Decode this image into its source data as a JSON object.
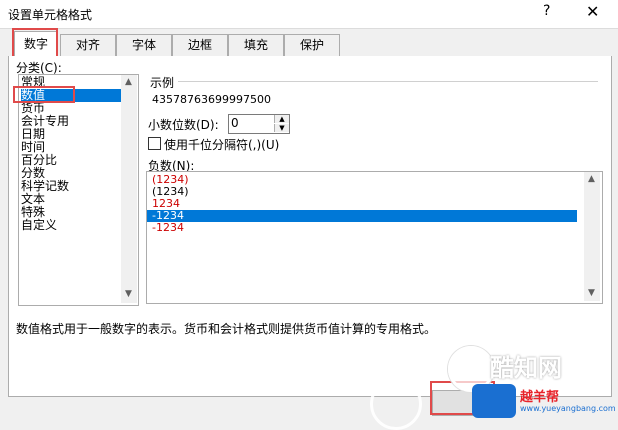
{
  "window": {
    "title": "设置单元格格式",
    "help_glyph": "?",
    "close_glyph": "✕"
  },
  "tabs": [
    {
      "label": "数字",
      "active": true
    },
    {
      "label": "对齐",
      "active": false
    },
    {
      "label": "字体",
      "active": false
    },
    {
      "label": "边框",
      "active": false
    },
    {
      "label": "填充",
      "active": false
    },
    {
      "label": "保护",
      "active": false
    }
  ],
  "category": {
    "label": "分类(C):",
    "items": [
      "常规",
      "数值",
      "货币",
      "会计专用",
      "日期",
      "时间",
      "百分比",
      "分数",
      "科学记数",
      "文本",
      "特殊",
      "自定义"
    ],
    "selected": "数值"
  },
  "sample": {
    "label": "示例",
    "value": "43578763699997500"
  },
  "decimals": {
    "label": "小数位数(D):",
    "value": "0"
  },
  "thousands": {
    "label": "使用千位分隔符(,)(U)",
    "checked": false
  },
  "negative": {
    "label": "负数(N):",
    "items": [
      {
        "text": "(1234)",
        "color": "#cc0000"
      },
      {
        "text": "(1234)",
        "color": "#000000"
      },
      {
        "text": "1234",
        "color": "#cc0000"
      },
      {
        "text": "-1234",
        "color": "#000000",
        "selected": true
      },
      {
        "text": "-1234",
        "color": "#cc0000"
      }
    ]
  },
  "description": "数值格式用于一般数字的表示。货币和会计格式则提供货币值计算的专用格式。",
  "watermark": {
    "brand": "酷知网",
    "site": "越羊帮",
    "url": "www.yueyangbang.com"
  },
  "colors": {
    "accent": "#0078d7",
    "highlight_red": "#e04a4a",
    "negative_red": "#cc0000"
  }
}
